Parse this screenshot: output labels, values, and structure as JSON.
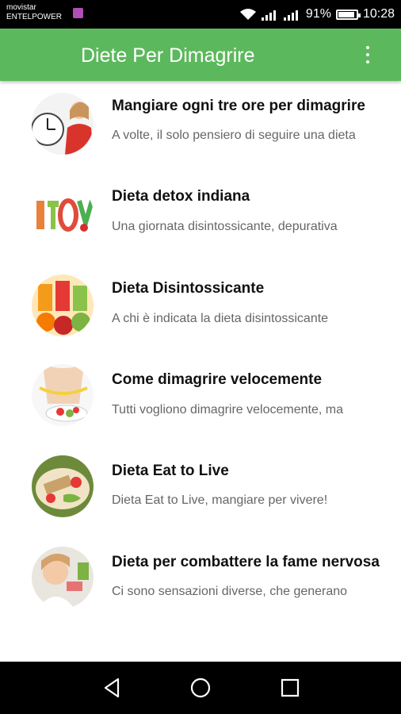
{
  "status_bar": {
    "carrier_line1": "movistar",
    "carrier_line2": "ENTELPOWER",
    "battery_percent": "91%",
    "battery_level": 0.91,
    "time": "10:28",
    "icons": [
      "app-notification-icon",
      "wifi-icon",
      "signal-icon",
      "signal-icon",
      "battery-icon"
    ]
  },
  "app_bar": {
    "title": "Diete Per Dimagrire",
    "menu_icon": "more-vert-icon"
  },
  "articles": [
    {
      "title": "Mangiare ogni tre ore per dimagrire",
      "subtitle": "A volte, il solo pensiero di seguire una dieta",
      "image": "clock-woman"
    },
    {
      "title": "Dieta detox indiana",
      "subtitle": "Una giornata disintossicante, depurativa",
      "image": "detox-vegetables"
    },
    {
      "title": "Dieta Disintossicante",
      "subtitle": "A chi è indicata la dieta disintossicante",
      "image": "juices-fruit"
    },
    {
      "title": "Come dimagrire velocemente",
      "subtitle": "Tutti vogliono dimagrire velocemente, ma",
      "image": "waist-tape"
    },
    {
      "title": "Dieta Eat to Live",
      "subtitle": "Dieta Eat to Live, mangiare per vivere!",
      "image": "salad-plate"
    },
    {
      "title": "Dieta per combattere la fame nervosa",
      "subtitle": "Ci sono sensazioni diverse, che generano",
      "image": "girl-eating"
    }
  ],
  "nav_bar": {
    "back_icon": "back-triangle-icon",
    "home_icon": "home-circle-icon",
    "recents_icon": "recents-square-icon"
  },
  "colors": {
    "primary": "#5cb85c",
    "title_text": "#111111",
    "subtitle_text": "#666666"
  }
}
